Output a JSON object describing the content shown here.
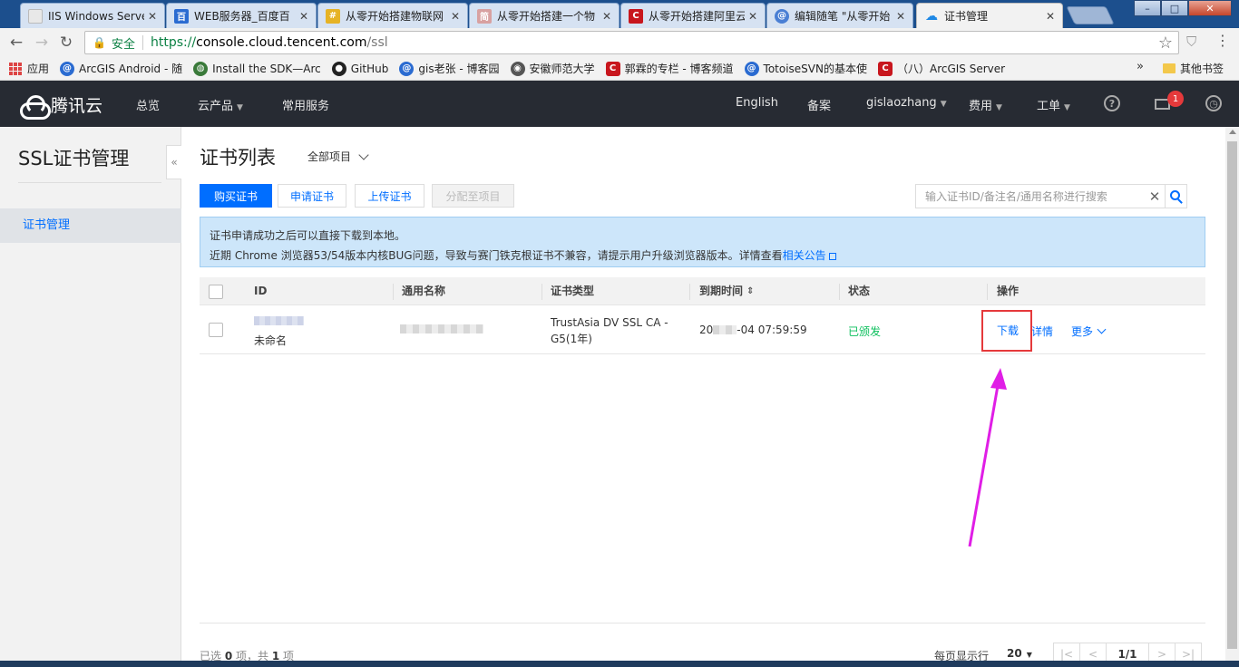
{
  "browser": {
    "tabs": [
      {
        "title": "IIS Windows Serve",
        "favicon_color": "#e8e8e8",
        "favicon_char": ""
      },
      {
        "title": "WEB服务器_百度百",
        "favicon_color": "#2a6bd1",
        "favicon_char": "百"
      },
      {
        "title": "从零开始搭建物联网",
        "favicon_color": "#e6b325",
        "favicon_char": "#"
      },
      {
        "title": "从零开始搭建一个物",
        "favicon_color": "#d8a1a1",
        "favicon_char": "简"
      },
      {
        "title": "从零开始搭建阿里云",
        "favicon_color": "#c8161d",
        "favicon_char": "C"
      },
      {
        "title": "编辑随笔 \"从零开始",
        "favicon_color": "#4a7fd4",
        "favicon_char": "@"
      },
      {
        "title": "证书管理",
        "favicon_color": "#1e88e5",
        "favicon_char": "☁"
      }
    ],
    "secure_label": "安全",
    "url_protocol": "https://",
    "url_host": "console.cloud.tencent.com",
    "url_path": "/ssl",
    "bookmarks": [
      {
        "label": "应用",
        "color": "#d44"
      },
      {
        "label": "ArcGIS Android - 随",
        "color": "#2a6bd1"
      },
      {
        "label": "Install the SDK—Arc",
        "color": "#3a7a3a"
      },
      {
        "label": "GitHub",
        "color": "#222"
      },
      {
        "label": "gis老张 - 博客园",
        "color": "#2a6bd1"
      },
      {
        "label": "安徽师范大学",
        "color": "#555"
      },
      {
        "label": "郭霖的专栏 - 博客频道",
        "color": "#c8161d"
      },
      {
        "label": "TotoiseSVN的基本使",
        "color": "#2a6bd1"
      },
      {
        "label": "（八）ArcGIS Server",
        "color": "#c8161d"
      }
    ],
    "bookmarks_more": "»",
    "other_bookmarks": "其他书签"
  },
  "header": {
    "brand": "腾讯云",
    "nav": [
      "总览",
      "云产品",
      "常用服务"
    ],
    "right": {
      "language": "English",
      "icp": "备案",
      "user": "gislaozhang",
      "billing": "费用",
      "ticket": "工单",
      "help_icon": "?",
      "mail_badge": "1"
    }
  },
  "sidebar": {
    "title": "SSL证书管理",
    "collapse_icon": "«",
    "items": [
      {
        "label": "证书管理",
        "active": true
      }
    ]
  },
  "main": {
    "title": "证书列表",
    "project_filter": "全部项目",
    "buttons": {
      "buy": "购买证书",
      "apply": "申请证书",
      "upload": "上传证书",
      "assign": "分配至项目"
    },
    "search": {
      "placeholder": "输入证书ID/备注名/通用名称进行搜索",
      "clear_icon": "✕"
    },
    "notice": {
      "line1": "证书申请成功之后可以直接下载到本地。",
      "line2": "近期 Chrome 浏览器53/54版本内核BUG问题，导致与赛门铁克根证书不兼容，请提示用户升级浏览器版本。详情查看",
      "link": "相关公告"
    },
    "table": {
      "columns": [
        "ID",
        "通用名称",
        "证书类型",
        "到期时间",
        "状态",
        "操作"
      ],
      "sort_icon": "⇕",
      "rows": [
        {
          "id_remark": "未命名",
          "type_line1": "TrustAsia DV SSL CA -",
          "type_line2": "G5(1年)",
          "expire_prefix": "20",
          "expire_suffix": "-04 07:59:59",
          "status": "已颁发",
          "actions": {
            "download": "下载",
            "detail": "详情",
            "more": "更多"
          }
        }
      ]
    },
    "footer": {
      "selected_prefix": "已选 ",
      "selected_count": "0",
      "selected_mid": " 项，共 ",
      "total_count": "1",
      "selected_suffix": " 项",
      "page_size_label": "每页显示行",
      "page_size": "20",
      "page": "1/1",
      "pager_first": "|<",
      "pager_prev": "<",
      "pager_next": ">",
      "pager_last": ">|"
    }
  },
  "colors": {
    "primary": "#006eff",
    "header_bg": "#272b33",
    "success": "#0abf5b",
    "annotation": "#e01ee6",
    "highlight": "#e5393b"
  }
}
